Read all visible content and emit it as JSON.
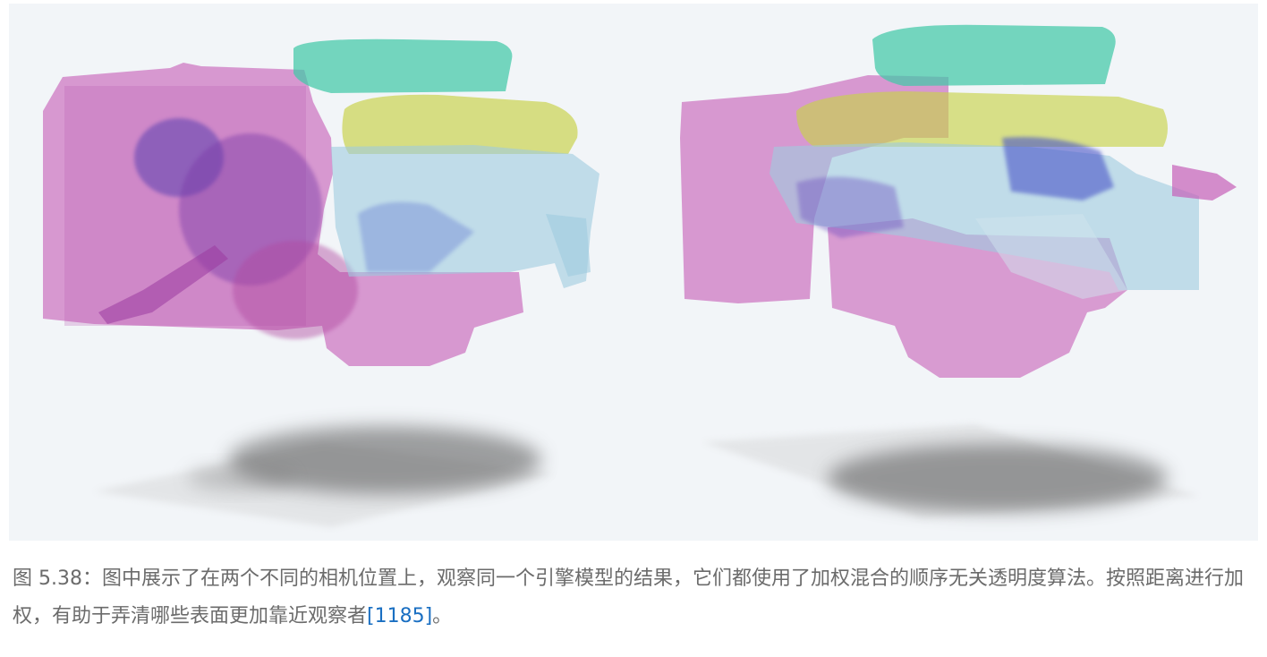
{
  "figure": {
    "icon": "engine-render-image",
    "colors": {
      "background": "#f2f5f8",
      "magenta": "#c65fb8",
      "teal": "#41c9a8",
      "yellow": "#c8d24a",
      "blue": "#5a6fd0",
      "light_blue": "#9fcbe0",
      "shadow": "#555555"
    }
  },
  "caption": {
    "label": "图 5.38",
    "separator": "：",
    "text": "图中展示了在两个不同的相机位置上，观察同一个引擎模型的结果，它们都使用了加权混合的顺序无关透明度算法。按照距离进行加权，有助于弄清哪些表面更加靠近观察者",
    "citation": "[1185]",
    "end": "。"
  }
}
